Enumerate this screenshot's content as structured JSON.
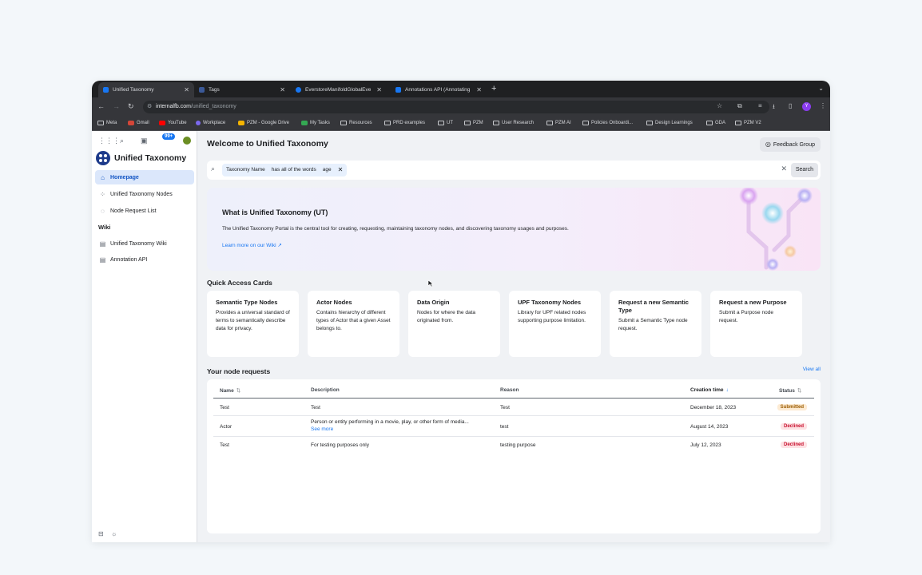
{
  "browser": {
    "tabs": [
      {
        "label": "Unified Taxonomy",
        "active": true,
        "color": "#1877f2"
      },
      {
        "label": "Tags",
        "active": false,
        "color": "#3b5998"
      },
      {
        "label": "EverstoreManifoldGlobalEve",
        "active": false,
        "color": "#1877f2"
      },
      {
        "label": "Annotations API (Annotating",
        "active": false,
        "color": "#1877f2"
      }
    ],
    "url_host": "internalfb.com",
    "url_path": "/unified_taxonomy",
    "profile_initial": "Y",
    "bookmarks": [
      "Meta",
      "Gmail",
      "YouTube",
      "Workplace",
      "PZM - Google Drive",
      "My Tasks",
      "Resources",
      "PRD examples",
      "UT",
      "PZM",
      "User Research",
      "PZM AI",
      "Policies Onboardi...",
      "Design Learnings",
      "GDA",
      "PZM V2"
    ]
  },
  "sidebar": {
    "notification_badge": "99+",
    "brand": "Unified Taxonomy",
    "items": [
      {
        "label": "Homepage",
        "icon": "home-icon"
      },
      {
        "label": "Unified Taxonomy Nodes",
        "icon": "nodes-icon"
      },
      {
        "label": "Node Request List",
        "icon": "check-circle-icon"
      }
    ],
    "wiki_heading": "Wiki",
    "wiki_items": [
      {
        "label": "Unified Taxonomy Wiki",
        "icon": "doc-icon"
      },
      {
        "label": "Annotation API",
        "icon": "doc-icon"
      }
    ]
  },
  "main": {
    "title": "Welcome to Unified Taxonomy",
    "feedback_label": "Feedback Group",
    "search": {
      "filter_field": "Taxonomy Name",
      "filter_op": "has all of the words",
      "filter_value": "age",
      "button": "Search"
    },
    "hero": {
      "title": "What is Unified Taxonomy (UT)",
      "description": "The Unified Taxonomy Portal is the central tool for creating, requesting, maintaining taxonomy nodes, and discovering taxonomy usages and purposes.",
      "link": "Learn more on our Wiki"
    },
    "quick_access_title": "Quick Access Cards",
    "cards": [
      {
        "title": "Semantic Type Nodes",
        "desc": "Provides a universal standard of terms to semantically describe data for privacy."
      },
      {
        "title": "Actor Nodes",
        "desc": "Contains hierarchy of different types of Actor that a given Asset belongs to."
      },
      {
        "title": "Data Origin",
        "desc": "Nodes for where the data originated from."
      },
      {
        "title": "UPF Taxonomy Nodes",
        "desc": "Library for UPF related nodes supporting purpose limitation."
      },
      {
        "title": "Request a new Semantic Type",
        "desc": "Submit a Semantic Type node request."
      },
      {
        "title": "Request a new Purpose",
        "desc": "Submit a Purpose node request."
      }
    ],
    "requests_title": "Your node requests",
    "view_all": "View all",
    "table": {
      "headers": {
        "name": "Name",
        "description": "Description",
        "reason": "Reason",
        "creation": "Creation time",
        "status": "Status"
      },
      "rows": [
        {
          "name": "Test",
          "description": "Test",
          "reason": "Test",
          "creation": "December 18, 2023",
          "status": "Submitted",
          "see_more": ""
        },
        {
          "name": "Actor",
          "description": "Person or entity performing in a movie, play, or other form of media...",
          "reason": "test",
          "creation": "August 14, 2023",
          "status": "Declined",
          "see_more": "See more"
        },
        {
          "name": "Test",
          "description": "For testing purposes only",
          "reason": "testing purpose",
          "creation": "July 12, 2023",
          "status": "Declined",
          "see_more": ""
        }
      ]
    }
  },
  "colors": {
    "accent": "#1877f2",
    "submitted": "#9a5b00",
    "declined": "#c8102e"
  }
}
